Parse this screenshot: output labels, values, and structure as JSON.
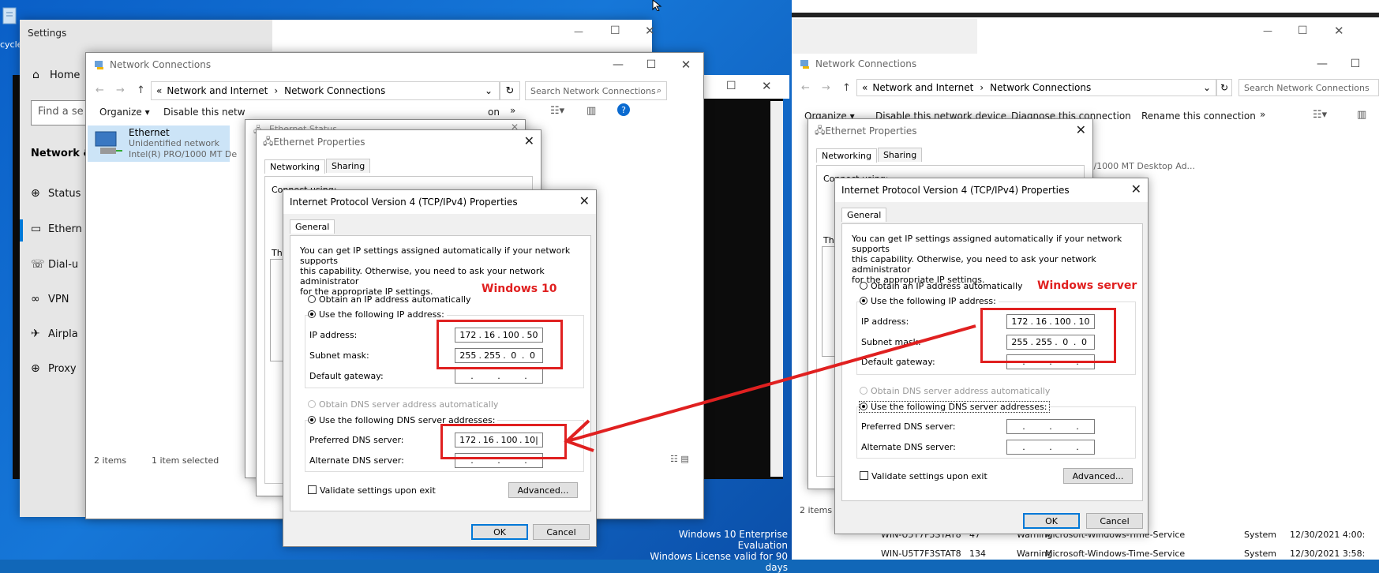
{
  "desktop": {
    "recycle_label": "cycle",
    "watermark": [
      "Windows 10 Enterprise Evaluation",
      "Windows License valid for 90 days"
    ]
  },
  "settings": {
    "title": "Settings",
    "home": "Home",
    "search_placeholder": "Find a se",
    "section": "Network &",
    "items": [
      "Status",
      "Ethern",
      "Dial-u",
      "VPN",
      "Airpla",
      "Proxy"
    ],
    "items_icons": [
      "globe-icon",
      "ethernet-icon",
      "dialup-icon",
      "vpn-icon",
      "airplane-icon",
      "globe-icon"
    ]
  },
  "netconn_left": {
    "title": "Network Connections",
    "breadcrumb": [
      "Network and Internet",
      "Network Connections"
    ],
    "search_placeholder": "Search Network Connections",
    "toolbar": [
      "Organize ▾",
      "Disable this netw",
      "on",
      "»"
    ],
    "adapter": {
      "name": "Ethernet",
      "status": "Unidentified network",
      "device": "Intel(R) PRO/1000 MT De"
    },
    "status_items": "2 items",
    "status_selected": "1 item selected"
  },
  "ethernet_status": {
    "title": "Ethernet Status"
  },
  "eth_props_left": {
    "title": "Ethernet Properties",
    "tabs": [
      "Networking",
      "Sharing"
    ],
    "connect_using": "Connect using:",
    "this_conn": "Th"
  },
  "ipv4_left": {
    "title": "Internet Protocol Version 4 (TCP/IPv4) Properties",
    "tab": "General",
    "intro": [
      "You can get IP settings assigned automatically if your network supports",
      "this capability. Otherwise, you need to ask your network administrator",
      "for the appropriate IP settings."
    ],
    "obtain_ip": "Obtain an IP address automatically",
    "use_ip": "Use the following IP address:",
    "ip_label": "IP address:",
    "ip": [
      "172",
      "16",
      "100",
      "50"
    ],
    "mask_label": "Subnet mask:",
    "mask": [
      "255",
      "255",
      "0",
      "0"
    ],
    "gw_label": "Default gateway:",
    "obtain_dns": "Obtain DNS server address automatically",
    "use_dns": "Use the following DNS server addresses:",
    "pref_label": "Preferred DNS server:",
    "pref": [
      "172",
      "16",
      "100",
      "10|"
    ],
    "alt_label": "Alternate DNS server:",
    "validate": "Validate settings upon exit",
    "advanced": "Advanced...",
    "ok": "OK",
    "cancel": "Cancel",
    "annotation": "Windows 10"
  },
  "netconn_right": {
    "title": "Network Connections",
    "breadcrumb": [
      "Network and Internet",
      "Network Connections"
    ],
    "search_placeholder": "Search Network Connections",
    "toolbar": [
      "Organize ▾",
      "Disable this network device",
      "Diagnose this connection",
      "Rename this connection",
      "»"
    ],
    "device_tail": "D/1000 MT Desktop Ad...",
    "status_items": "2 items"
  },
  "eth_props_right": {
    "title": "Ethernet Properties",
    "tabs": [
      "Networking",
      "Sharing"
    ],
    "connect_using": "Connect using:",
    "this_conn": "Th"
  },
  "ipv4_right": {
    "title": "Internet Protocol Version 4 (TCP/IPv4) Properties",
    "tab": "General",
    "intro": [
      "You can get IP settings assigned automatically if your network supports",
      "this capability. Otherwise, you need to ask your network administrator",
      "for the appropriate IP settings."
    ],
    "obtain_ip": "Obtain an IP address automatically",
    "use_ip": "Use the following IP address:",
    "ip_label": "IP address:",
    "ip": [
      "172",
      "16",
      "100",
      "10"
    ],
    "mask_label": "Subnet mask:",
    "mask": [
      "255",
      "255",
      "0",
      "0"
    ],
    "gw_label": "Default gateway:",
    "obtain_dns": "Obtain DNS server address automatically",
    "use_dns": "Use the following DNS server addresses:",
    "pref_label": "Preferred DNS server:",
    "alt_label": "Alternate DNS server:",
    "validate": "Validate settings upon exit",
    "advanced": "Advanced...",
    "ok": "OK",
    "cancel": "Cancel",
    "annotation": "Windows server"
  },
  "events": [
    {
      "computer": "WIN-U5T7F3STAT8",
      "id": "47",
      "level": "Warning",
      "source": "Microsoft-Windows-Time-Service",
      "log": "System",
      "date": "12/30/2021 4:00:"
    },
    {
      "computer": "WIN-U5T7F3STAT8",
      "id": "134",
      "level": "Warning",
      "source": "Microsoft-Windows-Time-Service",
      "log": "System",
      "date": "12/30/2021 3:58:"
    }
  ],
  "colors": {
    "annotation_red": "#e02020",
    "accent": "#0078d7"
  }
}
